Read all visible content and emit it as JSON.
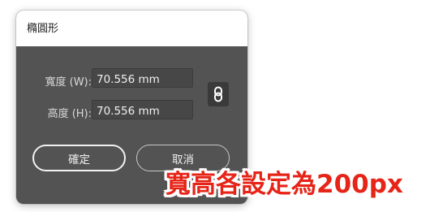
{
  "dialog": {
    "title": "橢圓形",
    "width": {
      "label": "寬度 (W):",
      "value": "70.556 mm"
    },
    "height": {
      "label": "高度 (H):",
      "value": "70.556 mm"
    },
    "constrain_icon": "chain-link-icon",
    "ok_label": "確定",
    "cancel_label": "取消"
  },
  "annotation": {
    "text": "寬高各設定為200px",
    "color": "#e62418"
  },
  "colors": {
    "dialog_bg": "#535353",
    "field_bg": "#474747",
    "titlebar_bg": "#ffffff"
  }
}
